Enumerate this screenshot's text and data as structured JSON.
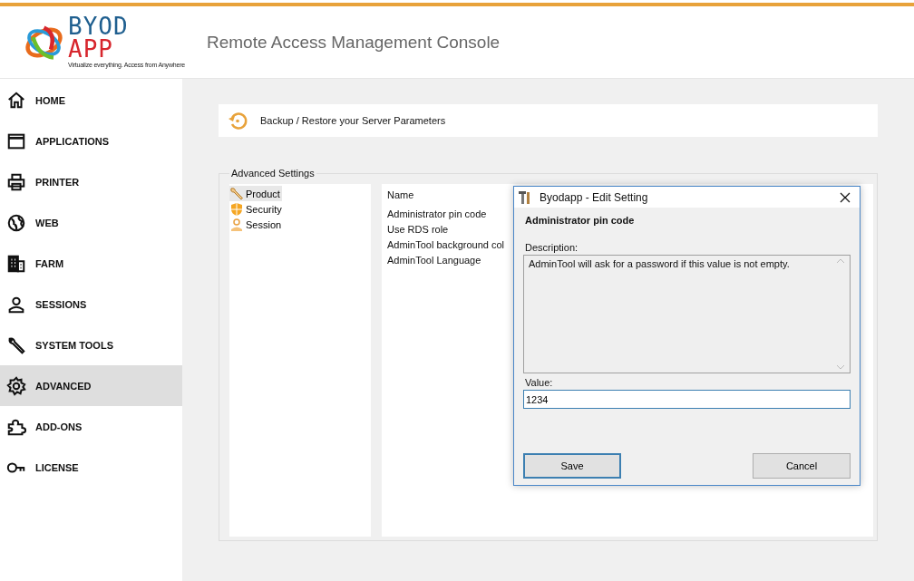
{
  "header": {
    "logo": {
      "line1": "BYOD",
      "line2": "APP",
      "tagline": "Virtualize everything. Access from Anywhere"
    },
    "title": "Remote Access Management Console"
  },
  "sidebar": {
    "items": [
      {
        "label": "HOME",
        "kind": "home",
        "selected": false
      },
      {
        "label": "APPLICATIONS",
        "kind": "window",
        "selected": false
      },
      {
        "label": "PRINTER",
        "kind": "printer",
        "selected": false
      },
      {
        "label": "WEB",
        "kind": "globe",
        "selected": false
      },
      {
        "label": "FARM",
        "kind": "building",
        "selected": false
      },
      {
        "label": "SESSIONS",
        "kind": "person",
        "selected": false
      },
      {
        "label": "SYSTEM TOOLS",
        "kind": "wrench",
        "selected": false
      },
      {
        "label": "ADVANCED",
        "kind": "gear",
        "selected": true
      },
      {
        "label": "ADD-ONS",
        "kind": "puzzle",
        "selected": false
      },
      {
        "label": "LICENSE",
        "kind": "key",
        "selected": false
      }
    ]
  },
  "backup_bar": {
    "label": "Backup / Restore your Server Parameters"
  },
  "advanced_settings": {
    "title": "Advanced Settings",
    "categories": [
      {
        "label": "Product",
        "kind": "wrench",
        "selected": true
      },
      {
        "label": "Security",
        "kind": "shield",
        "selected": false
      },
      {
        "label": "Session",
        "kind": "person",
        "selected": false
      }
    ],
    "list": {
      "column": "Name",
      "rows": [
        "Administrator pin code",
        "Use RDS role",
        "AdminTool background col",
        "AdminTool Language"
      ]
    }
  },
  "dialog": {
    "title": "Byodapp - Edit Setting",
    "setting_name": "Administrator pin code",
    "description_label": "Description:",
    "description": "AdminTool will ask for a password if this value is not empty.",
    "value_label": "Value:",
    "value": "1234",
    "buttons": [
      {
        "label": "Save",
        "selected": true
      },
      {
        "label": "Cancel",
        "selected": false
      }
    ]
  }
}
